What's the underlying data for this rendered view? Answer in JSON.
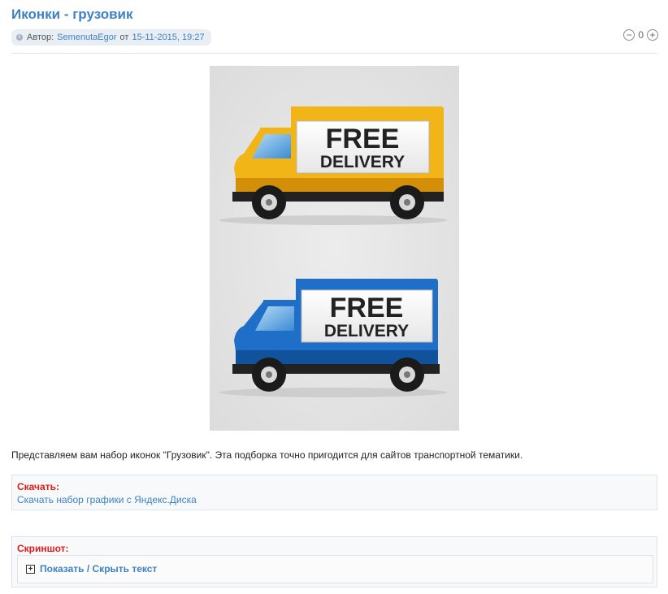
{
  "post": {
    "title": "Иконки - грузовик",
    "meta": {
      "author_prefix": "Автор:",
      "author": "SemenutaEgor",
      "date_prefix": "от",
      "date": "15-11-2015, 19:27"
    },
    "rating": {
      "value": "0",
      "minus_icon": "minus-circle-icon",
      "plus_icon": "plus-circle-icon"
    },
    "illustration": {
      "trucks": [
        {
          "color": "#f2b517",
          "dark": "#d48f08",
          "sign_line1": "FREE",
          "sign_line2": "DELIVERY"
        },
        {
          "color": "#1f6ec7",
          "dark": "#10529c",
          "sign_line1": "FREE",
          "sign_line2": "DELIVERY"
        }
      ]
    },
    "description": "Представляем вам набор иконок \"Грузовик\". Эта подборка точно пригодится для сайтов транспортной тематики.",
    "download": {
      "label": "Скачать:",
      "link": "Скачать набор графики с Яндекс.Диска"
    },
    "screenshot": {
      "label": "Скриншот:",
      "spoiler_icon": "plus-square-icon",
      "toggle": "Показать / Скрыть текст"
    }
  }
}
